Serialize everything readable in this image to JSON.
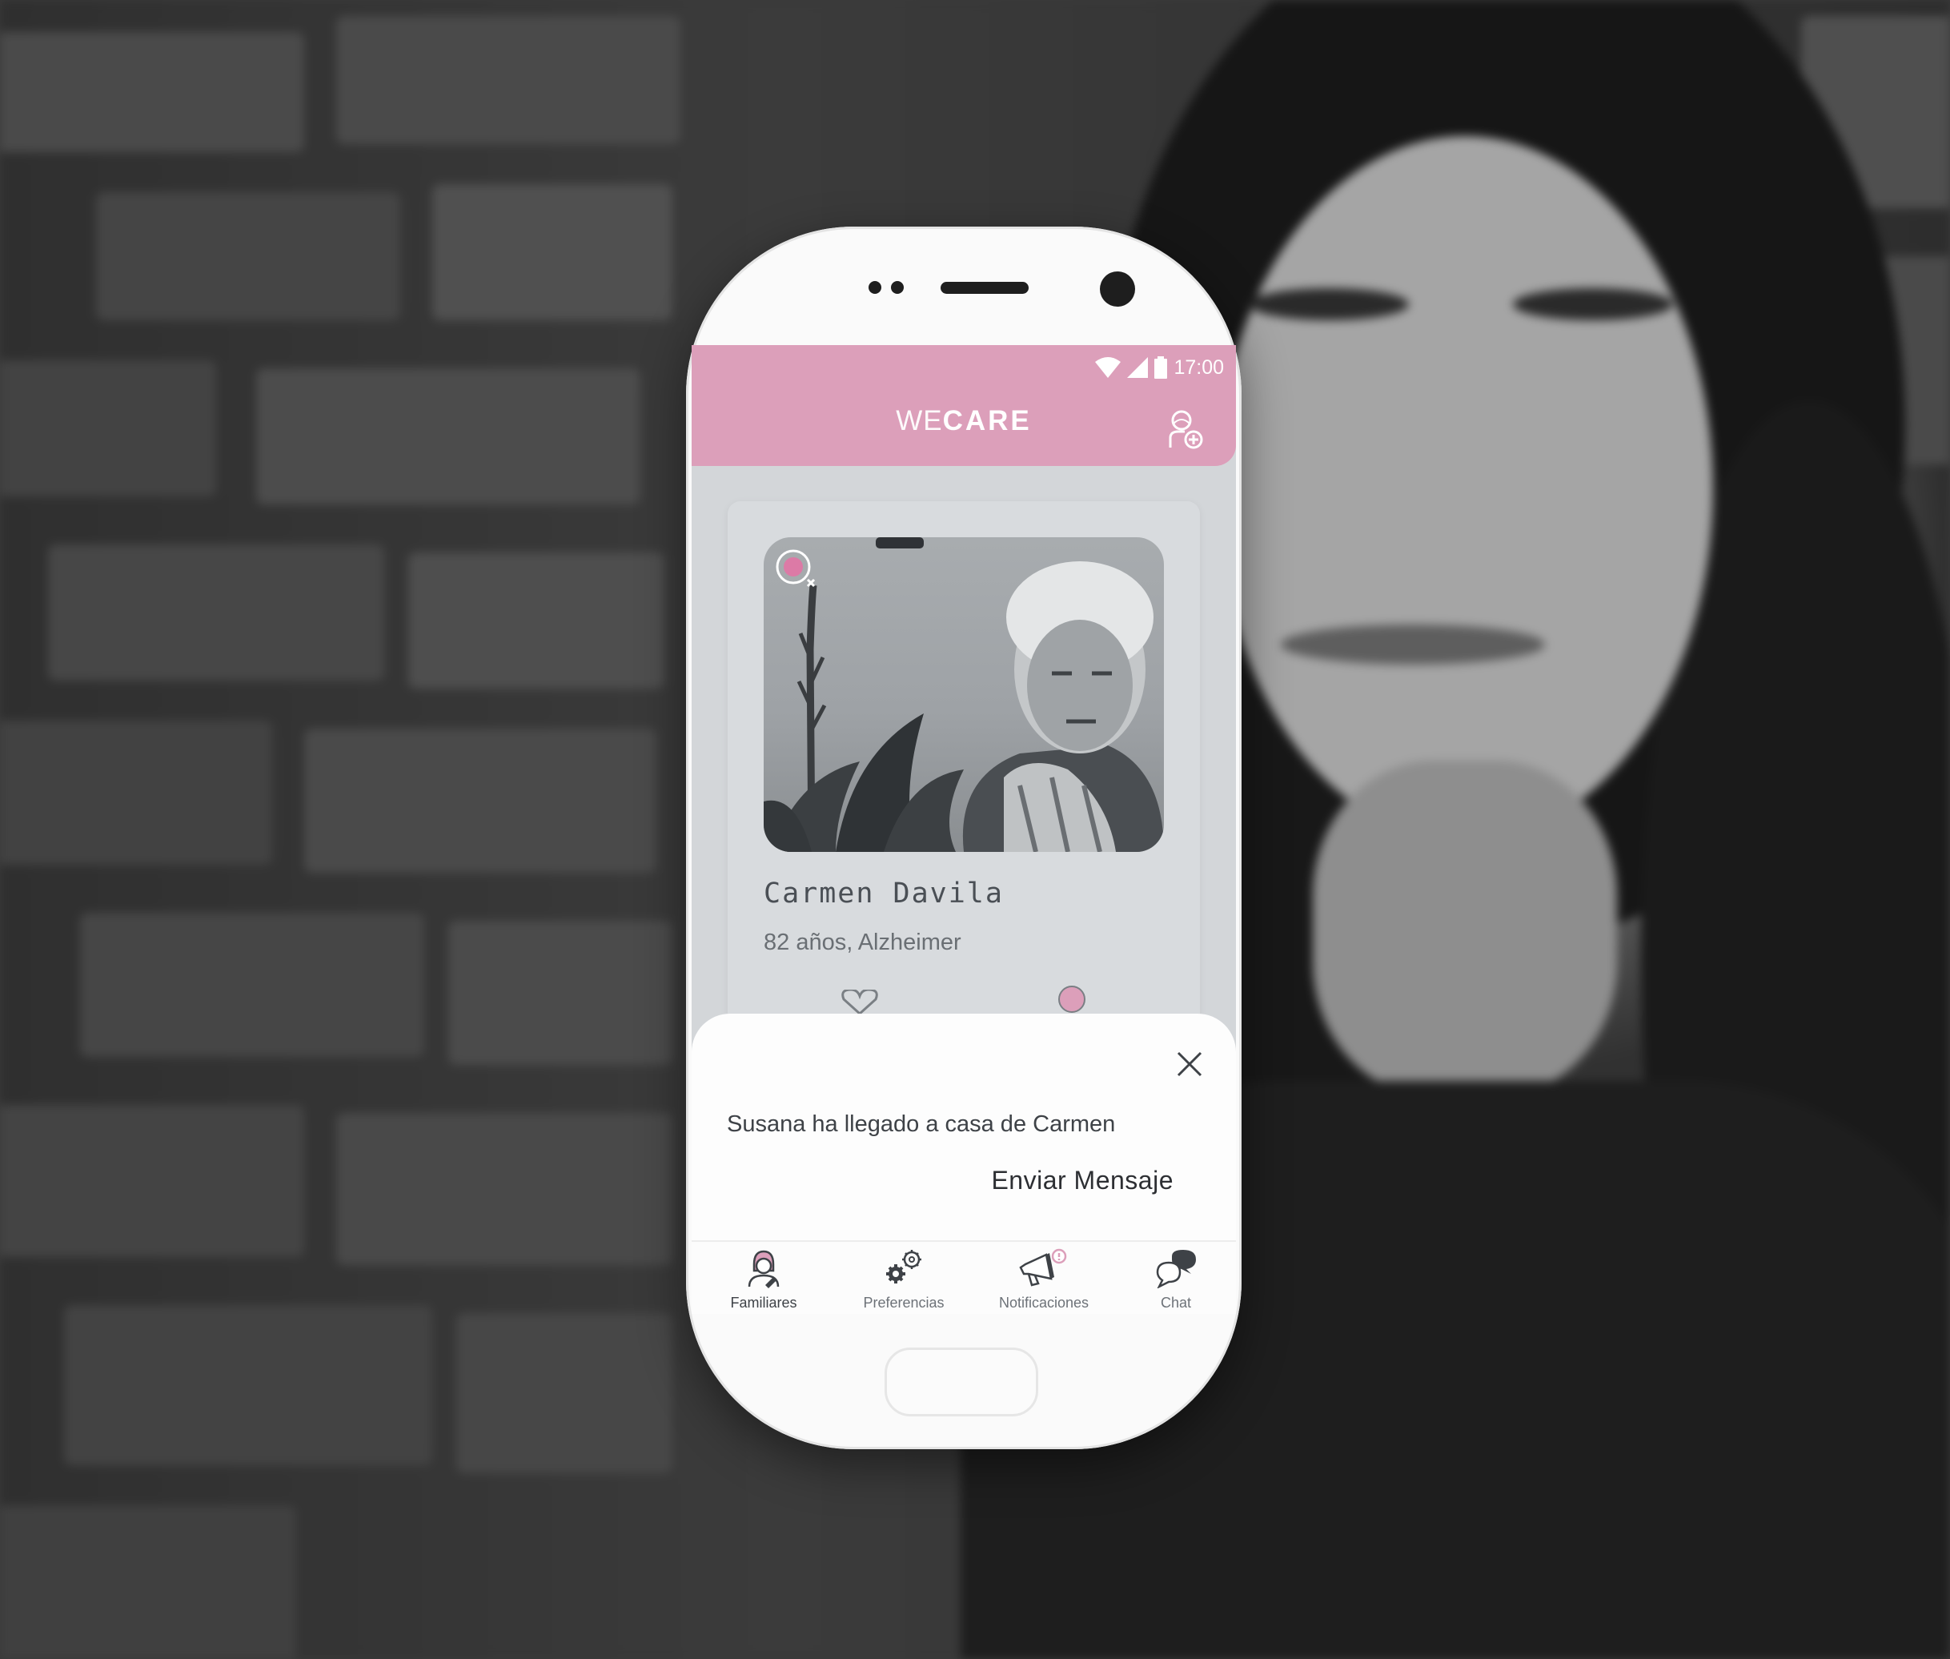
{
  "status_bar": {
    "time": "17:00"
  },
  "app_bar": {
    "brand_light": "WE",
    "brand_bold": "CARE",
    "add_icon": "add-user-icon"
  },
  "patient_card": {
    "name": "Carmen Davila",
    "details": "82 años, Alzheimer",
    "location_icon": "location-pin-icon"
  },
  "notification": {
    "message": "Susana ha llegado a casa de Carmen",
    "action": "Enviar Mensaje",
    "close_icon": "close-icon"
  },
  "tabs": [
    {
      "label": "Familiares",
      "icon": "familiares-icon",
      "active": true
    },
    {
      "label": "Preferencias",
      "icon": "gears-icon",
      "active": false
    },
    {
      "label": "Notificaciones",
      "icon": "megaphone-icon",
      "active": false
    },
    {
      "label": "Chat",
      "icon": "chat-bubbles-icon",
      "active": false
    }
  ],
  "colors": {
    "accent": "#dc9fba",
    "background_screen": "#d3d6d9",
    "text_dark": "#3e4247"
  }
}
